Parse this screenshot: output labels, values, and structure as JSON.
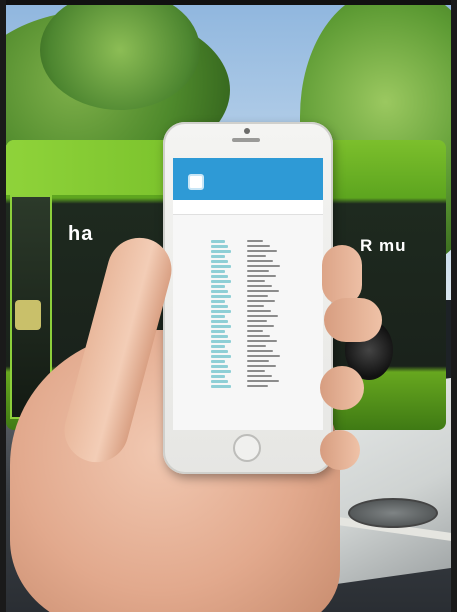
{
  "photo": {
    "bus_logo_left": "ha",
    "bus_logo_right": "R mu"
  },
  "phone": {
    "timetable_rows": 30
  },
  "colors": {
    "app_bar": "#2e9ad6",
    "bus_green": "#79c12b",
    "time_highlight": "#8fcfd6"
  }
}
